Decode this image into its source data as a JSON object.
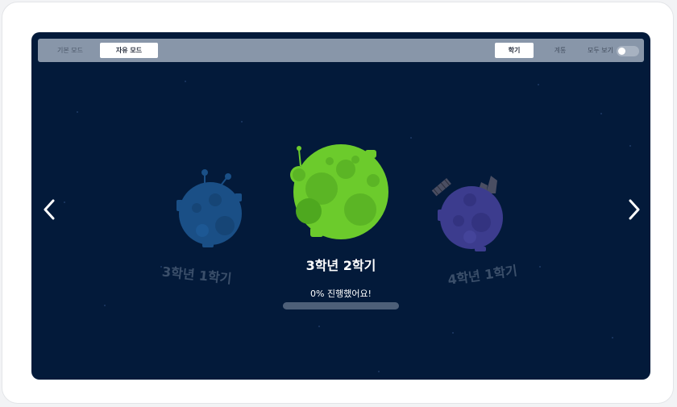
{
  "topbar": {
    "mode_basic": "기본 모드",
    "mode_free": "자유 모드",
    "tab_semester": "학기",
    "tab_series": "계통",
    "view_all": "모두 보기",
    "view_all_on": false
  },
  "carousel": {
    "prev_label": "‹",
    "next_label": "›",
    "left_planet": {
      "title": "3학년 1학기",
      "color": "#1a4f86"
    },
    "center_planet": {
      "title": "3학년 2학기",
      "progress_text": "0% 진행했어요!",
      "progress": 0,
      "color": "#6ccb2c"
    },
    "right_planet": {
      "title": "4학년 1학기",
      "color": "#3c3c8e"
    }
  },
  "colors": {
    "background": "#031a3a",
    "topbar": "#8896a9",
    "accent": "#7fd33b"
  }
}
